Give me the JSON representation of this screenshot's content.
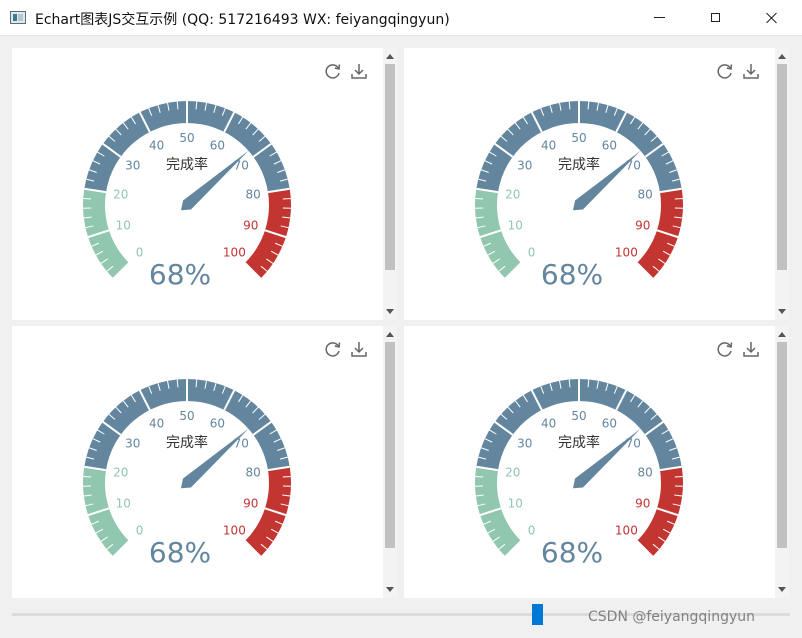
{
  "window": {
    "title": "Echart图表JS交互示例 (QQ: 517216493 WX: feiyangqingyun)"
  },
  "gauge": {
    "title": "完成率",
    "value_text": "68%",
    "value": 68,
    "min": 0,
    "max": 100,
    "tick_labels": [
      "0",
      "10",
      "20",
      "30",
      "40",
      "50",
      "60",
      "70",
      "80",
      "90",
      "100"
    ],
    "colors": {
      "low": "#91c7ae",
      "mid": "#63869e",
      "high": "#c23531",
      "title": "#333333"
    },
    "bands": [
      {
        "to": 0.2,
        "color": "#91c7ae"
      },
      {
        "to": 0.8,
        "color": "#63869e"
      },
      {
        "to": 1.0,
        "color": "#c23531"
      }
    ]
  },
  "toolbox": {
    "restore_icon": "refresh-icon",
    "save_icon": "download-icon"
  },
  "watermark": "CSDN @feiyangqingyun"
}
